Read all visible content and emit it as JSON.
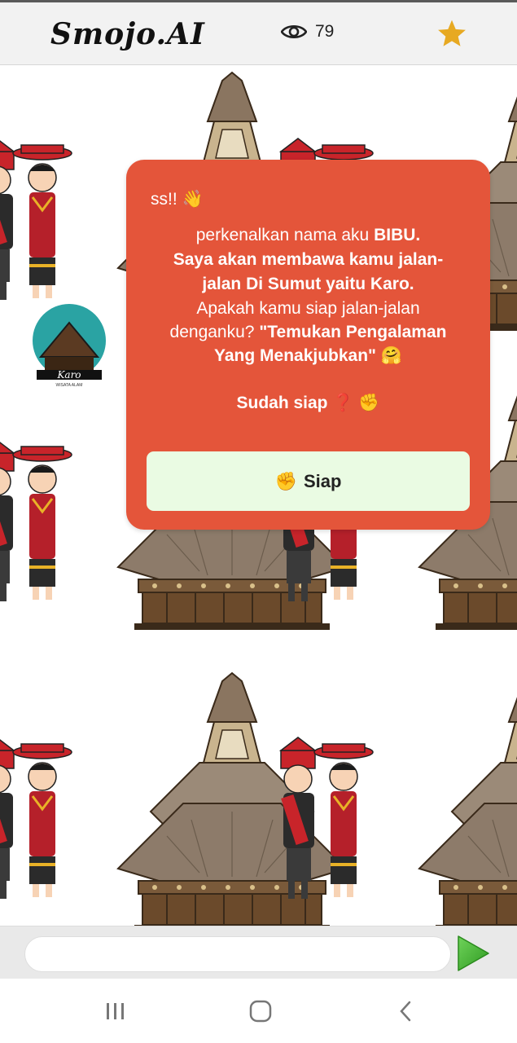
{
  "header": {
    "logo_text": "Smojo.AI",
    "view_count": "79",
    "eye_icon": "eye-icon",
    "star_icon": "star-icon",
    "star_color": "#e7a922"
  },
  "modal": {
    "line1": "ss!! 👋",
    "line2_prefix": "perkenalkan nama aku ",
    "line2_name": "BIBU.",
    "line3": "Saya akan membawa kamu jalan-",
    "line4": "jalan Di Sumut yaitu Karo.",
    "line5": "Apakah kamu siap jalan-jalan",
    "line6_prefix": "denganku? ",
    "line6_quote": "\"Temukan Pengalaman",
    "line7": "Yang Menakjubkan\" 🤗",
    "ready_question": "Sudah siap",
    "question_mark": "❓",
    "fist": "✊",
    "button_emoji": "✊",
    "button_label": "Siap",
    "background_color": "#e4553a",
    "button_color": "#eafbe3"
  },
  "background": {
    "badge_text": "Karo",
    "badge_subtext": "WISATA ALAM"
  },
  "input": {
    "value": "",
    "placeholder": "",
    "send_icon": "play-send-icon",
    "send_color": "#44b133"
  },
  "navbar": {
    "recents_icon": "recents-icon",
    "home_icon": "home-icon",
    "back_icon": "back-icon"
  }
}
